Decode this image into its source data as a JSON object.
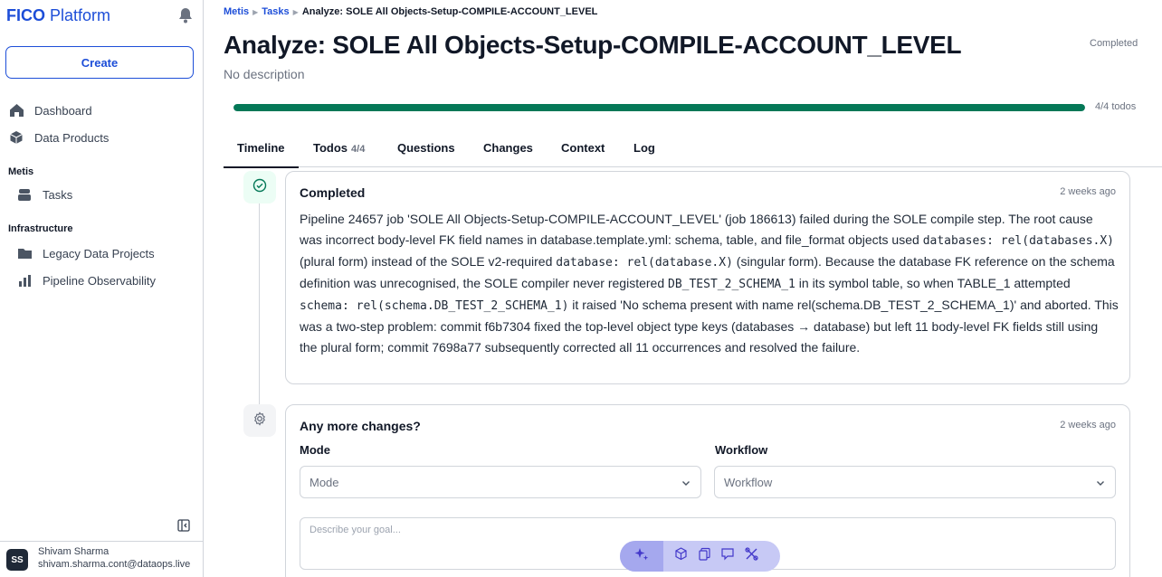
{
  "sidebar": {
    "brand_bold": "FICO",
    "brand_rest": "Platform",
    "create_label": "Create",
    "items_top": [
      {
        "label": "Dashboard",
        "icon": "home-icon"
      },
      {
        "label": "Data Products",
        "icon": "cube-icon"
      }
    ],
    "section_metis": "Metis",
    "metis_items": [
      {
        "label": "Tasks",
        "icon": "tasks-icon"
      }
    ],
    "section_infra": "Infrastructure",
    "infra_items": [
      {
        "label": "Legacy Data Projects",
        "icon": "folder-icon"
      },
      {
        "label": "Pipeline Observability",
        "icon": "bar-chart-icon"
      }
    ],
    "user": {
      "initials": "SS",
      "name": "Shivam Sharma",
      "email": "shivam.sharma.cont@dataops.live"
    }
  },
  "breadcrumb": {
    "root": "Metis",
    "parent": "Tasks",
    "current": "Analyze: SOLE All Objects-Setup-COMPILE-ACCOUNT_LEVEL"
  },
  "page": {
    "title": "Analyze: SOLE All Objects-Setup-COMPILE-ACCOUNT_LEVEL",
    "status": "Completed",
    "description": "No description",
    "progress_fraction": 1.0,
    "progress_label": "4/4 todos"
  },
  "tabs": [
    {
      "label": "Timeline",
      "count": ""
    },
    {
      "label": "Todos",
      "count": "4/4"
    },
    {
      "label": "Questions",
      "count": ""
    },
    {
      "label": "Changes",
      "count": ""
    },
    {
      "label": "Context",
      "count": ""
    },
    {
      "label": "Log",
      "count": ""
    }
  ],
  "timeline": {
    "completed_card": {
      "title": "Completed",
      "time": "2 weeks ago",
      "body": [
        {
          "t": "Pipeline 24657 job 'SOLE All Objects-Setup-COMPILE-ACCOUNT_LEVEL' (job 186613) failed during the SOLE compile step. The root cause was incorrect body-level FK field names in database.template.yml: schema, table, and file_format objects used "
        },
        {
          "c": "databases: rel(databases.X)"
        },
        {
          "t": " (plural form) instead of the SOLE v2-required "
        },
        {
          "c": "database: rel(database.X)"
        },
        {
          "t": " (singular form). Because the database FK reference on the schema definition was unrecognised, the SOLE compiler never registered "
        },
        {
          "c": "DB_TEST_2_SCHEMA_1"
        },
        {
          "t": " in its symbol table, so when TABLE_1 attempted "
        },
        {
          "c": "schema: rel(schema.DB_TEST_2_SCHEMA_1)"
        },
        {
          "t": " it raised 'No schema present with name rel(schema.DB_TEST_2_SCHEMA_1)' and aborted. This was a two-step problem: commit f6b7304 fixed the top-level object type keys (databases → database) but left 11 body-level FK fields still using the plural form; commit 7698a77 subsequently corrected all 11 occurrences and resolved the failure."
        }
      ]
    },
    "changes_card": {
      "title": "Any more changes?",
      "time": "2 weeks ago",
      "mode_label": "Mode",
      "mode_value": "Mode",
      "workflow_label": "Workflow",
      "workflow_value": "Workflow",
      "goal_placeholder": "Describe your goal..."
    }
  },
  "colors": {
    "accent": "#1d4ed8",
    "progress": "#047857",
    "toolbar": "#c7c9f5"
  }
}
